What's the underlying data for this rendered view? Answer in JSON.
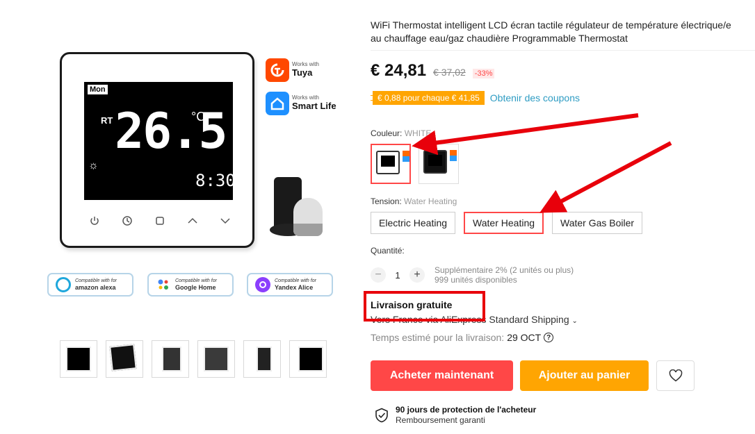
{
  "product": {
    "title_line1": "WiFi Thermostat intelligent LCD écran tactile régulateur de température électrique/e",
    "title_line2": "au chauffage eau/gaz chaudière Programmable Thermostat"
  },
  "gallery": {
    "screen_day": "Mon",
    "screen_mode": "RT",
    "screen_temp": "26.5",
    "screen_unit": "°C",
    "screen_time": "8:30",
    "badge_tuya_small": "Works with",
    "badge_tuya_big": "Tuya",
    "badge_smart_small": "Works with",
    "badge_smart_big": "Smart Life",
    "compat": [
      {
        "small": "Compatible with for",
        "big": "amazon alexa"
      },
      {
        "small": "Compatible with for",
        "big": "Google Home"
      },
      {
        "small": "Compatible with for",
        "big": "Yandex Alice"
      }
    ]
  },
  "price": {
    "current": "€ 24,81",
    "original": "€ 37,02",
    "discount": "-33%"
  },
  "coupon": {
    "tag": "€ 0,88 pour chaque € 41,85",
    "link": "Obtenir des coupons"
  },
  "color": {
    "label": "Couleur: ",
    "selected": "WHITE"
  },
  "tension": {
    "label": "Tension: ",
    "selected": "Water Heating",
    "options": [
      "Electric Heating",
      "Water Heating",
      "Water Gas Boiler"
    ]
  },
  "quantity": {
    "label": "Quantité:",
    "minus": "−",
    "value": "1",
    "plus": "+",
    "note_line1": "Supplémentaire 2% (2 unités ou plus)",
    "note_line2": "999 unités disponibles"
  },
  "shipping": {
    "free": "Livraison gratuite",
    "via": "Vers France via AliExpress Standard Shipping",
    "eta_label": "Temps estimé pour la livraison: ",
    "eta_date": "29 OCT",
    "help": "?"
  },
  "actions": {
    "buy": "Acheter maintenant",
    "cart": "Ajouter au panier"
  },
  "protection": {
    "title": "90 jours de protection de l'acheteur",
    "subtitle": "Remboursement garanti"
  },
  "colors": {
    "accent_red": "#ff4747",
    "accent_orange": "#ffa502",
    "link_blue": "#2e9cc3",
    "annotation_red": "#e8000b"
  }
}
